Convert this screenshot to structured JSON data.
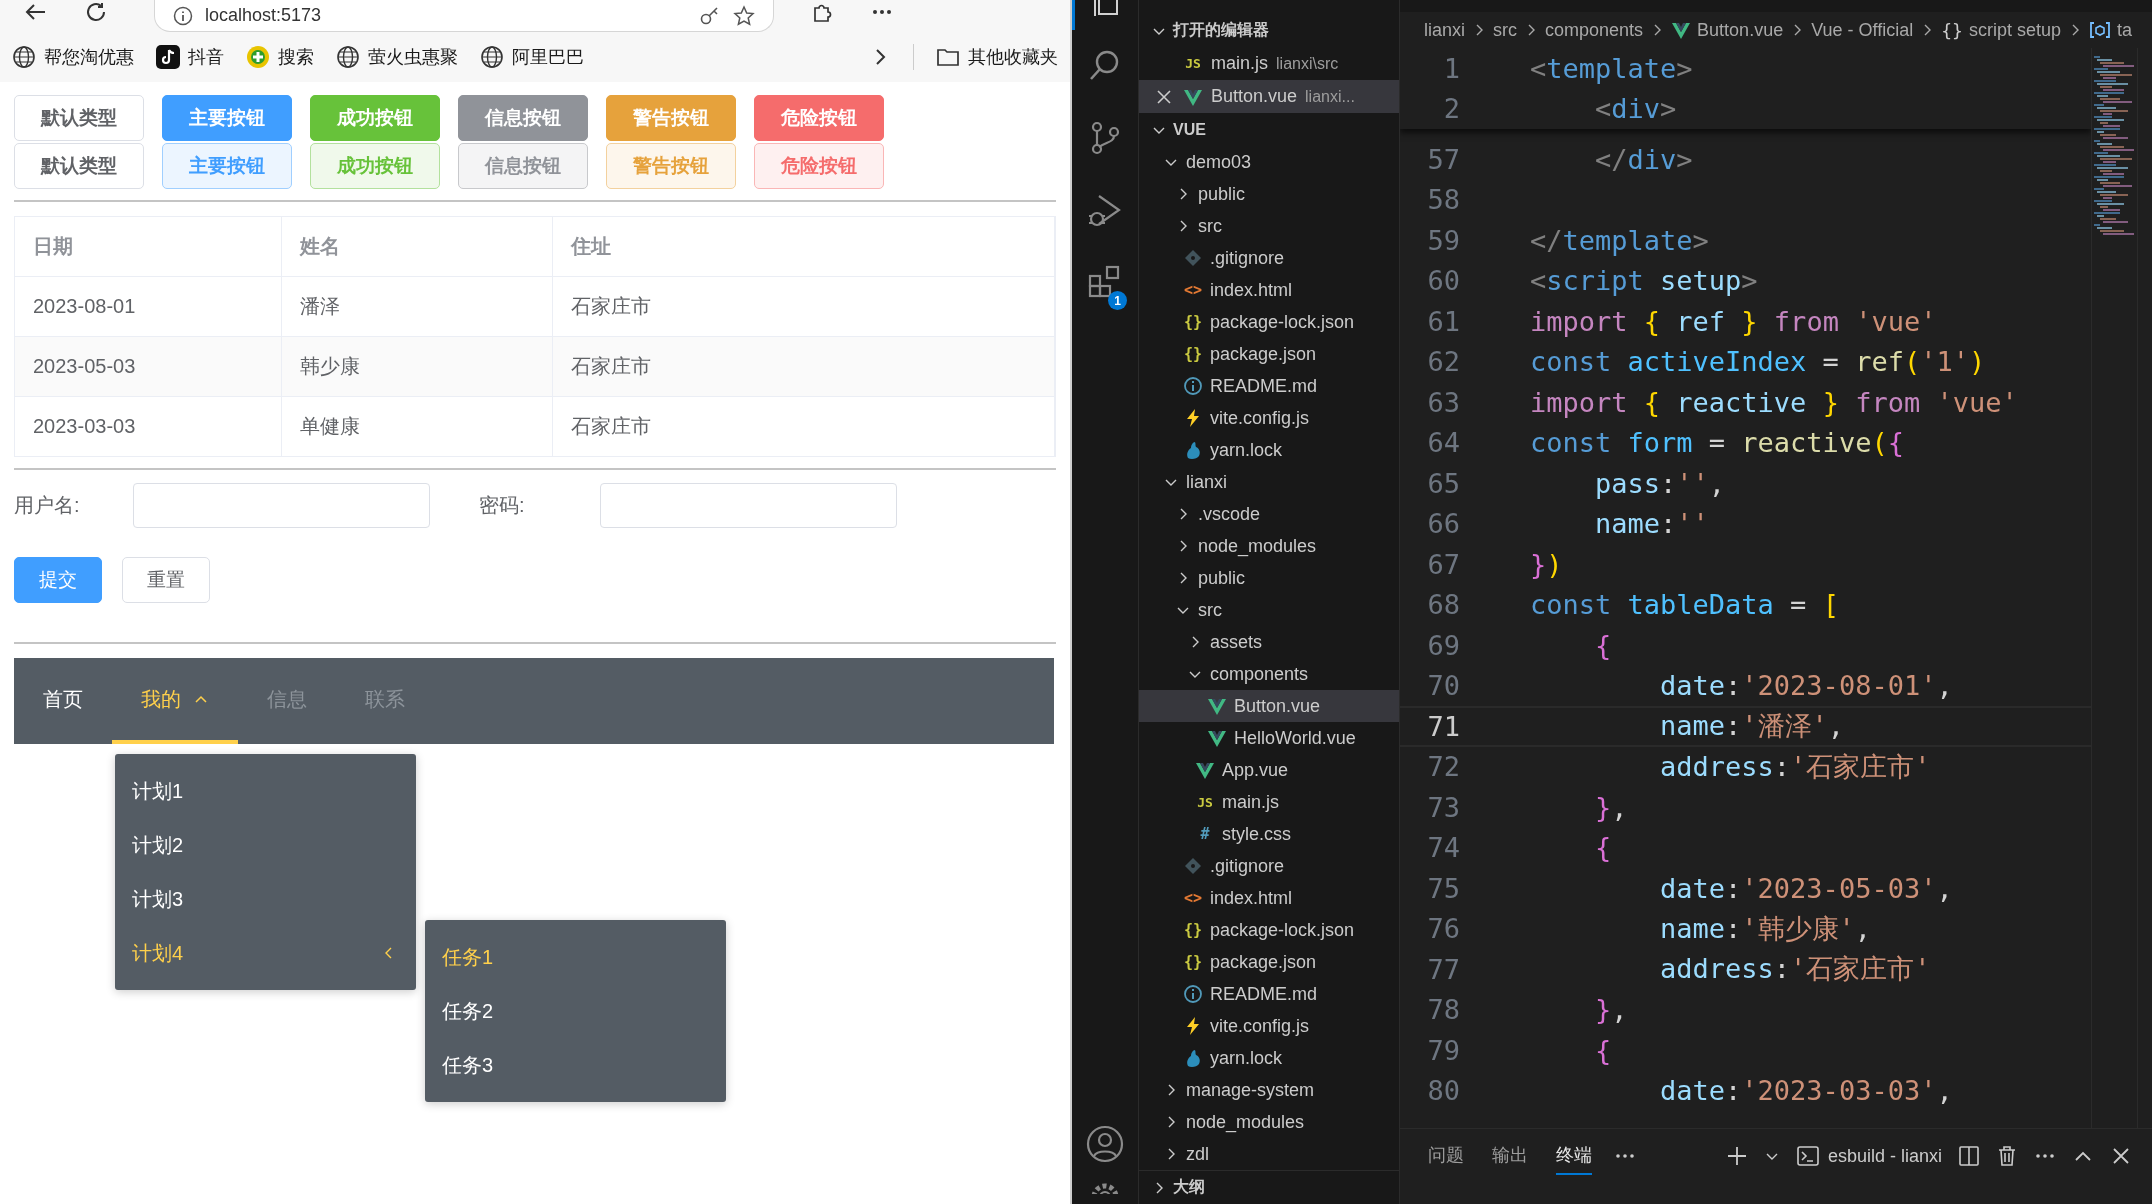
{
  "browser": {
    "address": "localhost:5173",
    "bookmarks": [
      {
        "label": "帮您淘优惠",
        "kind": "globe"
      },
      {
        "label": "抖音",
        "kind": "note"
      },
      {
        "label": "搜索",
        "kind": "ball"
      },
      {
        "label": "萤火虫惠聚",
        "kind": "globe"
      },
      {
        "label": "阿里巴巴",
        "kind": "globe"
      }
    ],
    "other_bookmarks": "其他收藏夹",
    "page": {
      "button_rows": [
        {
          "plain": false,
          "buttons": [
            {
              "label": "默认类型",
              "kind": "default"
            },
            {
              "label": "主要按钮",
              "kind": "primary"
            },
            {
              "label": "成功按钮",
              "kind": "success"
            },
            {
              "label": "信息按钮",
              "kind": "info"
            },
            {
              "label": "警告按钮",
              "kind": "warning"
            },
            {
              "label": "危险按钮",
              "kind": "danger"
            }
          ]
        },
        {
          "plain": true,
          "buttons": [
            {
              "label": "默认类型",
              "kind": "default"
            },
            {
              "label": "主要按钮",
              "kind": "primary"
            },
            {
              "label": "成功按钮",
              "kind": "success"
            },
            {
              "label": "信息按钮",
              "kind": "info"
            },
            {
              "label": "警告按钮",
              "kind": "warning"
            },
            {
              "label": "危险按钮",
              "kind": "danger"
            }
          ]
        }
      ],
      "table": {
        "striped": true,
        "columns": [
          "日期",
          "姓名",
          "住址"
        ],
        "rows": [
          [
            "2023-08-01",
            "潘泽",
            "石家庄市"
          ],
          [
            "2023-05-03",
            "韩少康",
            "石家庄市"
          ],
          [
            "2023-03-03",
            "单健康",
            "石家庄市"
          ]
        ]
      },
      "form": {
        "fields": [
          {
            "label": "用户名:"
          },
          {
            "label": "密码:"
          }
        ],
        "buttons": [
          {
            "label": "提交",
            "kind": "primary"
          },
          {
            "label": "重置",
            "kind": "default"
          }
        ]
      },
      "menu": {
        "items": [
          {
            "label": "首页",
            "selected": false,
            "disabled": false
          },
          {
            "label": "我的",
            "selected": true,
            "disabled": false,
            "expanded": true,
            "children": [
              {
                "label": "计划1",
                "selected": false
              },
              {
                "label": "计划2",
                "selected": false
              },
              {
                "label": "计划3",
                "selected": false
              },
              {
                "label": "计划4",
                "selected": true,
                "expanded": true,
                "children": [
                  {
                    "label": "任务1",
                    "selected": true
                  },
                  {
                    "label": "任务2",
                    "selected": false
                  },
                  {
                    "label": "任务3",
                    "selected": false
                  }
                ]
              }
            ]
          },
          {
            "label": "信息",
            "selected": false,
            "disabled": true
          },
          {
            "label": "联系",
            "selected": false,
            "disabled": true
          }
        ]
      }
    }
  },
  "activity_bar": {
    "extensions_count": "1"
  },
  "explorer": {
    "open_editors": {
      "title": "打开的编辑器",
      "expanded": true,
      "items": [
        {
          "name": "main.js",
          "path": "lianxi\\src",
          "kind": "js",
          "glyph": "JS",
          "selected": false
        },
        {
          "name": "Button.vue",
          "path": "lianxi...",
          "kind": "vue",
          "selected": true
        }
      ]
    },
    "workspace": {
      "title": "VUE",
      "expanded": true,
      "tree": [
        {
          "name": "demo03",
          "kind": "folder",
          "expanded": true,
          "selected": false,
          "children": [
            {
              "name": "public",
              "kind": "folder",
              "expanded": false,
              "selected": false
            },
            {
              "name": "src",
              "kind": "folder",
              "expanded": false,
              "selected": false
            },
            {
              "name": ".gitignore",
              "kind": "git",
              "selected": false
            },
            {
              "name": "index.html",
              "kind": "html",
              "glyph": "<>",
              "selected": false
            },
            {
              "name": "package-lock.json",
              "kind": "json",
              "glyph": "{}",
              "selected": false
            },
            {
              "name": "package.json",
              "kind": "json",
              "glyph": "{}",
              "selected": false
            },
            {
              "name": "README.md",
              "kind": "info",
              "selected": false
            },
            {
              "name": "vite.config.js",
              "kind": "vite",
              "selected": false
            },
            {
              "name": "yarn.lock",
              "kind": "yarn",
              "selected": false
            }
          ]
        },
        {
          "name": "lianxi",
          "kind": "folder",
          "expanded": true,
          "selected": false,
          "children": [
            {
              "name": ".vscode",
              "kind": "folder",
              "expanded": false,
              "selected": false
            },
            {
              "name": "node_modules",
              "kind": "folder",
              "expanded": false,
              "selected": false
            },
            {
              "name": "public",
              "kind": "folder",
              "expanded": false,
              "selected": false
            },
            {
              "name": "src",
              "kind": "folder",
              "expanded": true,
              "selected": false,
              "children": [
                {
                  "name": "assets",
                  "kind": "folder",
                  "expanded": false,
                  "selected": false
                },
                {
                  "name": "components",
                  "kind": "folder",
                  "expanded": true,
                  "selected": false,
                  "children": [
                    {
                      "name": "Button.vue",
                      "kind": "vue",
                      "selected": true
                    },
                    {
                      "name": "HelloWorld.vue",
                      "kind": "vue",
                      "selected": false
                    }
                  ]
                },
                {
                  "name": "App.vue",
                  "kind": "vue",
                  "selected": false
                },
                {
                  "name": "main.js",
                  "kind": "js",
                  "glyph": "JS",
                  "selected": false
                },
                {
                  "name": "style.css",
                  "kind": "css",
                  "glyph": "#",
                  "selected": false
                }
              ]
            },
            {
              "name": ".gitignore",
              "kind": "git",
              "selected": false
            },
            {
              "name": "index.html",
              "kind": "html",
              "glyph": "<>",
              "selected": false
            },
            {
              "name": "package-lock.json",
              "kind": "json",
              "glyph": "{}",
              "selected": false
            },
            {
              "name": "package.json",
              "kind": "json",
              "glyph": "{}",
              "selected": false
            },
            {
              "name": "README.md",
              "kind": "info",
              "selected": false
            },
            {
              "name": "vite.config.js",
              "kind": "vite",
              "selected": false
            },
            {
              "name": "yarn.lock",
              "kind": "yarn",
              "selected": false
            }
          ]
        },
        {
          "name": "manage-system",
          "kind": "folder",
          "expanded": false,
          "selected": false
        },
        {
          "name": "node_modules",
          "kind": "folder",
          "expanded": false,
          "selected": false
        },
        {
          "name": "zdl",
          "kind": "folder",
          "expanded": false,
          "selected": false
        }
      ]
    },
    "outline": {
      "title": "大纲",
      "expanded": false
    }
  },
  "editor": {
    "breadcrumbs": [
      {
        "label": "lianxi",
        "kind": "plain"
      },
      {
        "label": "src",
        "kind": "plain"
      },
      {
        "label": "components",
        "kind": "plain"
      },
      {
        "label": "Button.vue",
        "kind": "vue"
      },
      {
        "label": "Vue - Official",
        "kind": "plain"
      },
      {
        "label": "script setup",
        "kind": "symbol",
        "glyph": "{}"
      },
      {
        "label": "ta",
        "kind": "variable"
      }
    ],
    "sticky_lines": [
      {
        "number": "1",
        "current": false,
        "tokens": [
          {
            "kind": "bracket",
            "text": "<"
          },
          {
            "kind": "tag",
            "text": "template"
          },
          {
            "kind": "bracket",
            "text": ">"
          }
        ]
      },
      {
        "number": "2",
        "current": false,
        "tokens": [
          {
            "kind": "bracket",
            "text": "    <"
          },
          {
            "kind": "tag",
            "text": "div"
          },
          {
            "kind": "bracket",
            "text": ">"
          }
        ]
      }
    ],
    "lines": [
      {
        "number": "57",
        "current": false,
        "tokens": [
          {
            "kind": "bracket",
            "text": "    </"
          },
          {
            "kind": "tag",
            "text": "div"
          },
          {
            "kind": "bracket",
            "text": ">"
          }
        ]
      },
      {
        "number": "58",
        "current": false
      },
      {
        "number": "59",
        "current": false,
        "tokens": [
          {
            "kind": "bracket",
            "text": "</"
          },
          {
            "kind": "tag",
            "text": "template"
          },
          {
            "kind": "bracket",
            "text": ">"
          }
        ]
      },
      {
        "number": "60",
        "current": false,
        "tokens": [
          {
            "kind": "bracket",
            "text": "<"
          },
          {
            "kind": "tag",
            "text": "script"
          },
          {
            "kind": "attr",
            "text": " setup"
          },
          {
            "kind": "bracket",
            "text": ">"
          }
        ]
      },
      {
        "number": "61",
        "current": false,
        "tokens": [
          {
            "kind": "keyword",
            "text": "import"
          },
          {
            "kind": "brace1",
            "text": " {"
          },
          {
            "kind": "variable",
            "text": " ref "
          },
          {
            "kind": "brace1",
            "text": "}"
          },
          {
            "kind": "keyword",
            "text": " from"
          },
          {
            "kind": "string",
            "text": " 'vue'"
          }
        ]
      },
      {
        "number": "62",
        "current": false,
        "tokens": [
          {
            "kind": "storage",
            "text": "const"
          },
          {
            "kind": "constant",
            "text": " activeIndex"
          },
          {
            "kind": "plain",
            "text": " = "
          },
          {
            "kind": "function",
            "text": "ref"
          },
          {
            "kind": "brace1",
            "text": "("
          },
          {
            "kind": "string",
            "text": "'1'"
          },
          {
            "kind": "brace1",
            "text": ")"
          }
        ]
      },
      {
        "number": "63",
        "current": false,
        "tokens": [
          {
            "kind": "keyword",
            "text": "import"
          },
          {
            "kind": "brace1",
            "text": " {"
          },
          {
            "kind": "variable",
            "text": " reactive "
          },
          {
            "kind": "brace1",
            "text": "}"
          },
          {
            "kind": "keyword",
            "text": " from"
          },
          {
            "kind": "string",
            "text": " 'vue'"
          }
        ]
      },
      {
        "number": "64",
        "current": false,
        "tokens": [
          {
            "kind": "storage",
            "text": "const"
          },
          {
            "kind": "constant",
            "text": " form"
          },
          {
            "kind": "plain",
            "text": " = "
          },
          {
            "kind": "function",
            "text": "reactive"
          },
          {
            "kind": "brace1",
            "text": "("
          },
          {
            "kind": "brace2",
            "text": "{"
          }
        ]
      },
      {
        "number": "65",
        "current": false,
        "tokens": [
          {
            "kind": "variable",
            "text": "    pass"
          },
          {
            "kind": "plain",
            "text": ":"
          },
          {
            "kind": "string",
            "text": "''"
          },
          {
            "kind": "plain",
            "text": ","
          }
        ]
      },
      {
        "number": "66",
        "current": false,
        "tokens": [
          {
            "kind": "variable",
            "text": "    name"
          },
          {
            "kind": "plain",
            "text": ":"
          },
          {
            "kind": "string",
            "text": "''"
          }
        ]
      },
      {
        "number": "67",
        "current": false,
        "tokens": [
          {
            "kind": "brace2",
            "text": "}"
          },
          {
            "kind": "brace1",
            "text": ")"
          }
        ]
      },
      {
        "number": "68",
        "current": false,
        "tokens": [
          {
            "kind": "storage",
            "text": "const"
          },
          {
            "kind": "constant",
            "text": " tableData"
          },
          {
            "kind": "plain",
            "text": " = "
          },
          {
            "kind": "brace1",
            "text": "["
          }
        ]
      },
      {
        "number": "69",
        "current": false,
        "tokens": [
          {
            "kind": "brace2",
            "text": "    {"
          }
        ]
      },
      {
        "number": "70",
        "current": false,
        "tokens": [
          {
            "kind": "variable",
            "text": "        date"
          },
          {
            "kind": "plain",
            "text": ":"
          },
          {
            "kind": "string",
            "text": "'2023-08-01'"
          },
          {
            "kind": "plain",
            "text": ","
          }
        ]
      },
      {
        "number": "71",
        "current": true,
        "tokens": [
          {
            "kind": "variable",
            "text": "        name"
          },
          {
            "kind": "plain",
            "text": ":"
          },
          {
            "kind": "string",
            "text": "'潘泽'"
          },
          {
            "kind": "plain",
            "text": ","
          }
        ]
      },
      {
        "number": "72",
        "current": false,
        "tokens": [
          {
            "kind": "variable",
            "text": "        address"
          },
          {
            "kind": "plain",
            "text": ":"
          },
          {
            "kind": "string",
            "text": "'石家庄市'"
          }
        ]
      },
      {
        "number": "73",
        "current": false,
        "tokens": [
          {
            "kind": "brace2",
            "text": "    }"
          },
          {
            "kind": "plain",
            "text": ","
          }
        ]
      },
      {
        "number": "74",
        "current": false,
        "tokens": [
          {
            "kind": "brace2",
            "text": "    {"
          }
        ]
      },
      {
        "number": "75",
        "current": false,
        "tokens": [
          {
            "kind": "variable",
            "text": "        date"
          },
          {
            "kind": "plain",
            "text": ":"
          },
          {
            "kind": "string",
            "text": "'2023-05-03'"
          },
          {
            "kind": "plain",
            "text": ","
          }
        ]
      },
      {
        "number": "76",
        "current": false,
        "tokens": [
          {
            "kind": "variable",
            "text": "        name"
          },
          {
            "kind": "plain",
            "text": ":"
          },
          {
            "kind": "string",
            "text": "'韩少康'"
          },
          {
            "kind": "plain",
            "text": ","
          }
        ]
      },
      {
        "number": "77",
        "current": false,
        "tokens": [
          {
            "kind": "variable",
            "text": "        address"
          },
          {
            "kind": "plain",
            "text": ":"
          },
          {
            "kind": "string",
            "text": "'石家庄市'"
          }
        ]
      },
      {
        "number": "78",
        "current": false,
        "tokens": [
          {
            "kind": "brace2",
            "text": "    }"
          },
          {
            "kind": "plain",
            "text": ","
          }
        ]
      },
      {
        "number": "79",
        "current": false,
        "tokens": [
          {
            "kind": "brace2",
            "text": "    {"
          }
        ]
      },
      {
        "number": "80",
        "current": false,
        "tokens": [
          {
            "kind": "variable",
            "text": "        date"
          },
          {
            "kind": "plain",
            "text": ":"
          },
          {
            "kind": "string",
            "text": "'2023-03-03'"
          },
          {
            "kind": "plain",
            "text": ","
          }
        ]
      }
    ]
  },
  "panel": {
    "tabs": [
      {
        "label": "问题",
        "selected": false
      },
      {
        "label": "输出",
        "selected": false
      },
      {
        "label": "终端",
        "selected": true
      }
    ],
    "terminal": "esbuild - lianxi"
  }
}
